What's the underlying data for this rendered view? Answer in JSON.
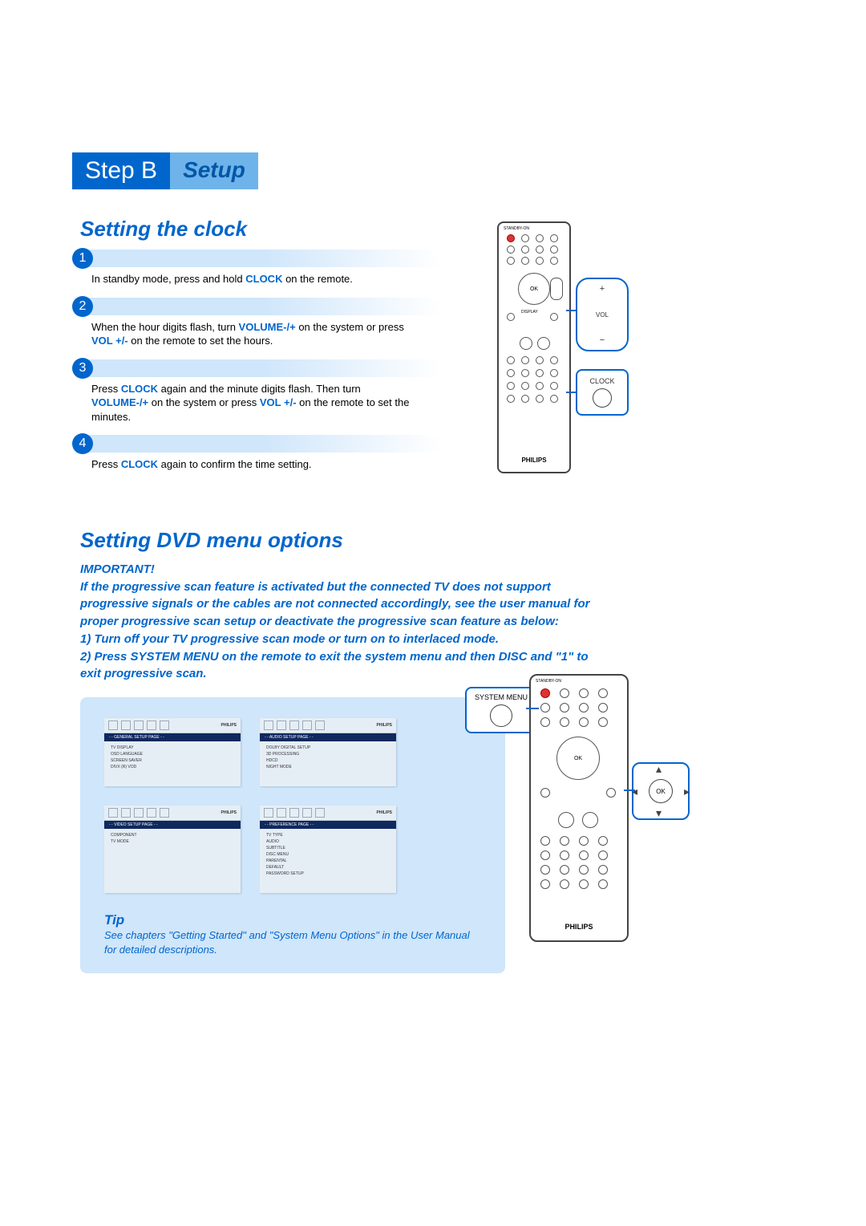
{
  "banner": {
    "left": "Step B",
    "right": "Setup"
  },
  "section1": {
    "title": "Setting the clock",
    "steps": [
      {
        "num": "1",
        "text": "In standby mode, press and hold <b>CLOCK</b> on the remote."
      },
      {
        "num": "2",
        "text": "When the hour digits flash, turn <b>VOLUME-/+</b> on the system or press <b>VOL +/-</b> on the remote to set the hours."
      },
      {
        "num": "3",
        "text": "Press <b>CLOCK</b> again and the minute digits flash. Then turn <b>VOLUME-/+</b> on the system or press <b>VOL +/-</b> on the remote to set the minutes."
      },
      {
        "num": "4",
        "text": "Press <b>CLOCK</b> again to confirm the time setting."
      }
    ]
  },
  "callouts": {
    "vol_plus": "+",
    "vol_label": "VOL",
    "vol_minus": "−",
    "clock_label": "CLOCK",
    "sysmenu_label": "SYSTEM MENU",
    "ok_label": "OK",
    "brand": "PHILIPS",
    "standby_label": "STANDBY-ON"
  },
  "section2": {
    "title": "Setting DVD menu options",
    "important_heading": "IMPORTANT!",
    "important_body": "If the progressive scan feature is activated but the connected TV does not support progressive signals or the cables are not connected accordingly, see the user manual for proper progressive scan setup or deactivate the progressive scan feature as below:\n1) Turn off your TV progressive scan mode or turn on to interlaced mode.\n2) Press SYSTEM MENU on the remote to exit the system menu and then DISC and \"1\" to exit progressive scan."
  },
  "menus": {
    "brand": "PHILIPS",
    "general": {
      "title": "- - GENERAL  SETUP  PAGE - -",
      "items": [
        "TV DISPLAY",
        "OSD LANGUAGE",
        "SCREEN SAVER",
        "DIVX (R) VOD"
      ]
    },
    "audio": {
      "title": "- - AUDIO  SETUP  PAGE - -",
      "items": [
        "DOLBY DIGITAL SETUP",
        "3D PROCESSING",
        "HDCD",
        "NIGHT MODE"
      ]
    },
    "video": {
      "title": "- - VIDEO  SETUP  PAGE - -",
      "items": [
        "COMPONENT",
        "TV MODE"
      ]
    },
    "pref": {
      "title": "- - PREFERENCE  PAGE - -",
      "items": [
        "TV TYPE",
        "AUDIO",
        "SUBTITLE",
        "DISC MENU",
        "PARENTAL",
        "DEFAULT",
        "PASSWORD SETUP"
      ]
    }
  },
  "tip": {
    "heading": "Tip",
    "body": "See chapters \"Getting Started\" and \"System Menu Options\" in the User Manual for detailed descriptions."
  }
}
